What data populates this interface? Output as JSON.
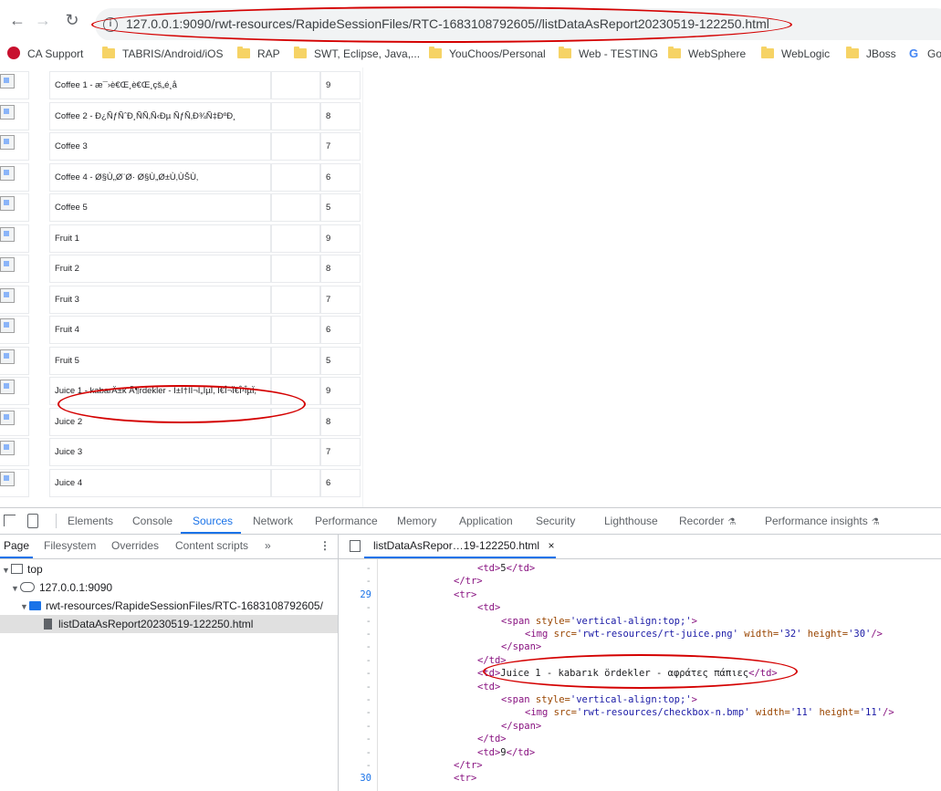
{
  "browser": {
    "url": "127.0.0.1:9090/rwt-resources/RapideSessionFiles/RTC-1683108792605//listDataAsReport20230519-122250.html",
    "bookmarks": [
      {
        "label": "CA Support",
        "icon": "ca-icon"
      },
      {
        "label": "TABRIS/Android/iOS",
        "icon": "folder-icon"
      },
      {
        "label": "RAP",
        "icon": "folder-icon"
      },
      {
        "label": "SWT, Eclipse, Java,...",
        "icon": "folder-icon"
      },
      {
        "label": "YouChoos/Personal",
        "icon": "folder-icon"
      },
      {
        "label": "Web - TESTING",
        "icon": "folder-icon"
      },
      {
        "label": "WebSphere",
        "icon": "folder-icon"
      },
      {
        "label": "WebLogic",
        "icon": "folder-icon"
      },
      {
        "label": "JBoss",
        "icon": "folder-icon"
      },
      {
        "label": "Go",
        "icon": "google-icon"
      }
    ]
  },
  "report": {
    "rows": [
      {
        "name": "Coffee 1 - æ¯›è€Œ¸è€Œ¸çš„é¸­å­",
        "value": "9"
      },
      {
        "name": "Coffee 2 - Ð¿ÑƒÑˆÐ¸ÑÑ‚Ñ‹Ðµ ÑƒÑ‚Ð¾Ñ‡ÐºÐ¸",
        "value": "8"
      },
      {
        "name": "Coffee 3",
        "value": "7"
      },
      {
        "name": "Coffee 4 - Ø§Ù„Ø¨Ø· Ø§Ù„Ø±Ù‚ÙŠÙ‚",
        "value": "6"
      },
      {
        "name": "Coffee 5",
        "value": "5"
      },
      {
        "name": "Fruit 1",
        "value": "9"
      },
      {
        "name": "Fruit 2",
        "value": "8"
      },
      {
        "name": "Fruit 3",
        "value": "7"
      },
      {
        "name": "Fruit 4",
        "value": "6"
      },
      {
        "name": "Fruit 5",
        "value": "5"
      },
      {
        "name": "Juice 1 - kabarÄ±k Ã¶rdekler - Î±Ï†ÏÎ¬Ï„ÎµÏ‚ Ï€Î¬Ï€Î¹ÎµÏ‚",
        "value": "9"
      },
      {
        "name": "Juice 2",
        "value": "8"
      },
      {
        "name": "Juice 3",
        "value": "7"
      },
      {
        "name": "Juice 4",
        "value": "6"
      }
    ]
  },
  "devtools": {
    "tabs": [
      "Elements",
      "Console",
      "Sources",
      "Network",
      "Performance",
      "Memory",
      "Application",
      "Security",
      "Lighthouse",
      "Recorder",
      "Performance insights"
    ],
    "active_tab": "Sources",
    "navigator_tabs": [
      "Page",
      "Filesystem",
      "Overrides",
      "Content scripts"
    ],
    "more_tabs": "»",
    "menu": "⋮",
    "tree": {
      "top": "top",
      "host": "127.0.0.1:9090",
      "folder": "rwt-resources/RapideSessionFiles/RTC-1683108792605/",
      "file": "listDataAsReport20230519-122250.html"
    },
    "editor_tab": "listDataAsRepor…19-122250.html",
    "editor_close": "×",
    "code_lines": [
      {
        "ln": "-",
        "html": "<td>5</td>",
        "indent": 4
      },
      {
        "ln": "-",
        "html": "</tr>",
        "indent": 3
      },
      {
        "ln": "29",
        "html": "<tr>",
        "indent": 3
      },
      {
        "ln": "-",
        "html": "<td>",
        "indent": 4
      },
      {
        "ln": "-",
        "html": "<span style='vertical-align:top;'>",
        "indent": 5
      },
      {
        "ln": "-",
        "html": "<img src='rwt-resources/rt-juice.png' width='32' height='30'/>",
        "indent": 6
      },
      {
        "ln": "-",
        "html": "</span>",
        "indent": 5
      },
      {
        "ln": "-",
        "html": "</td>",
        "indent": 4
      },
      {
        "ln": "-",
        "html": "<td>Juice 1 - kabarık ördekler - αφράτες πάπιες</td>",
        "indent": 4
      },
      {
        "ln": "-",
        "html": "<td>",
        "indent": 4
      },
      {
        "ln": "-",
        "html": "<span style='vertical-align:top;'>",
        "indent": 5
      },
      {
        "ln": "-",
        "html": "<img src='rwt-resources/checkbox-n.bmp' width='11' height='11'/>",
        "indent": 6
      },
      {
        "ln": "-",
        "html": "</span>",
        "indent": 5
      },
      {
        "ln": "-",
        "html": "</td>",
        "indent": 4
      },
      {
        "ln": "-",
        "html": "<td>9</td>",
        "indent": 4
      },
      {
        "ln": "-",
        "html": "</tr>",
        "indent": 3
      },
      {
        "ln": "30",
        "html": "<tr>",
        "indent": 3
      }
    ]
  },
  "colors": {
    "accent": "#1a73e8",
    "annotation": "#d40000",
    "tag": "#881280",
    "attr": "#994500",
    "value": "#1a1aa6"
  }
}
